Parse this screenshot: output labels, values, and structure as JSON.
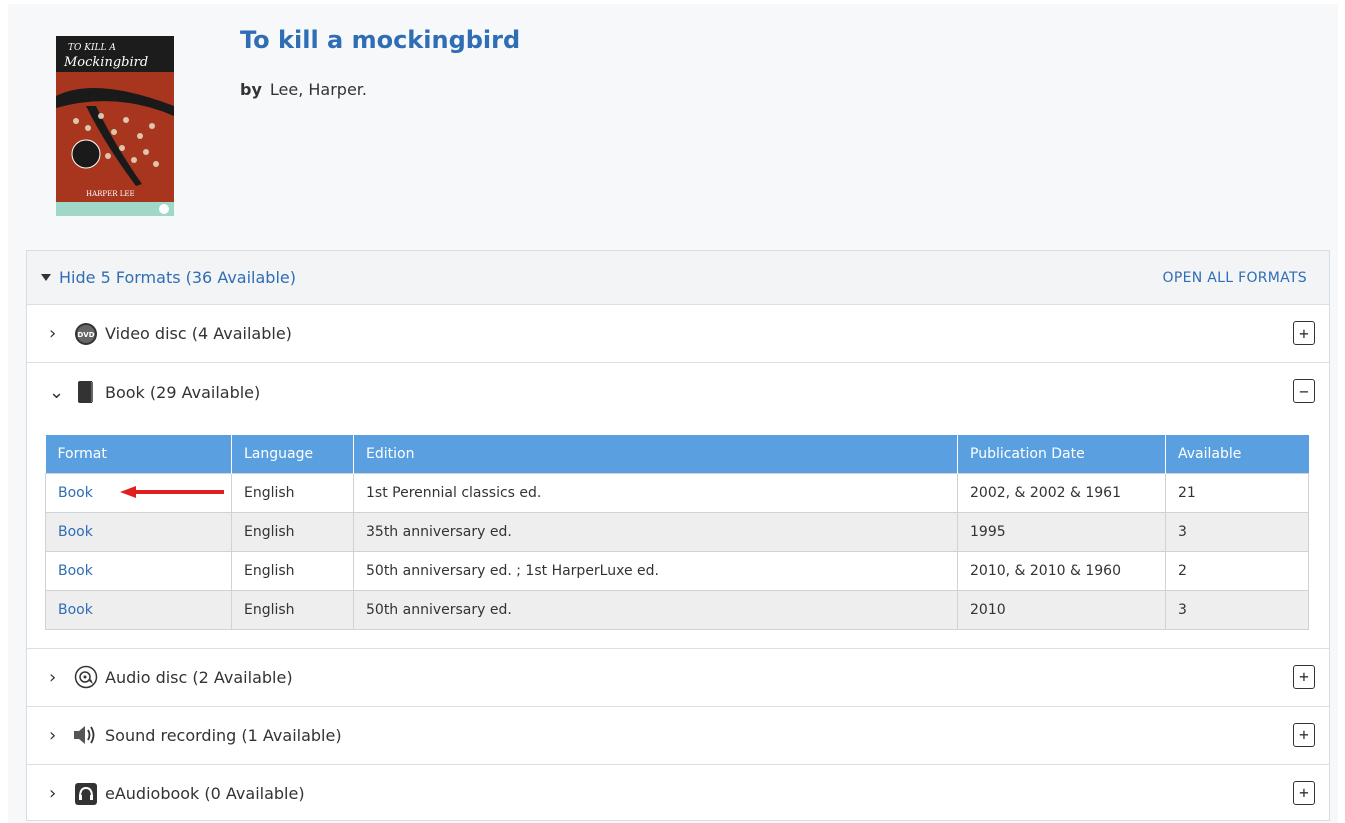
{
  "book": {
    "title": "To kill a mockingbird",
    "by_label": "by",
    "author": "Lee, Harper."
  },
  "formats_panel": {
    "hide_label": "Hide 5 Formats (36 Available)",
    "open_all_label": "OPEN ALL FORMATS"
  },
  "formats": [
    {
      "label": "Video disc (4 Available)",
      "icon": "dvd-icon",
      "expanded": false
    },
    {
      "label": "Book (29 Available)",
      "icon": "book-icon",
      "expanded": true
    },
    {
      "label": "Audio disc (2 Available)",
      "icon": "audio-disc-icon",
      "expanded": false
    },
    {
      "label": "Sound recording (1 Available)",
      "icon": "speaker-icon",
      "expanded": false
    },
    {
      "label": "eAudiobook (0 Available)",
      "icon": "headphones-icon",
      "expanded": false
    }
  ],
  "edition_table": {
    "headers": [
      "Format",
      "Language",
      "Edition",
      "Publication Date",
      "Available"
    ],
    "rows": [
      [
        "Book",
        "English",
        "1st Perennial classics ed.",
        "2002, & 2002 & 1961",
        "21"
      ],
      [
        "Book",
        "English",
        "35th anniversary ed.",
        "1995",
        "3"
      ],
      [
        "Book",
        "English",
        "50th anniversary ed. ; 1st HarperLuxe ed.",
        "2010, & 2010 & 1960",
        "2"
      ],
      [
        "Book",
        "English",
        "50th anniversary ed.",
        "2010",
        "3"
      ]
    ]
  },
  "buttons": {
    "expand": "+",
    "collapse": "−"
  },
  "colors": {
    "link": "#2f6db5",
    "table_header": "#5aa0e0",
    "annotation_arrow": "#e02020"
  }
}
